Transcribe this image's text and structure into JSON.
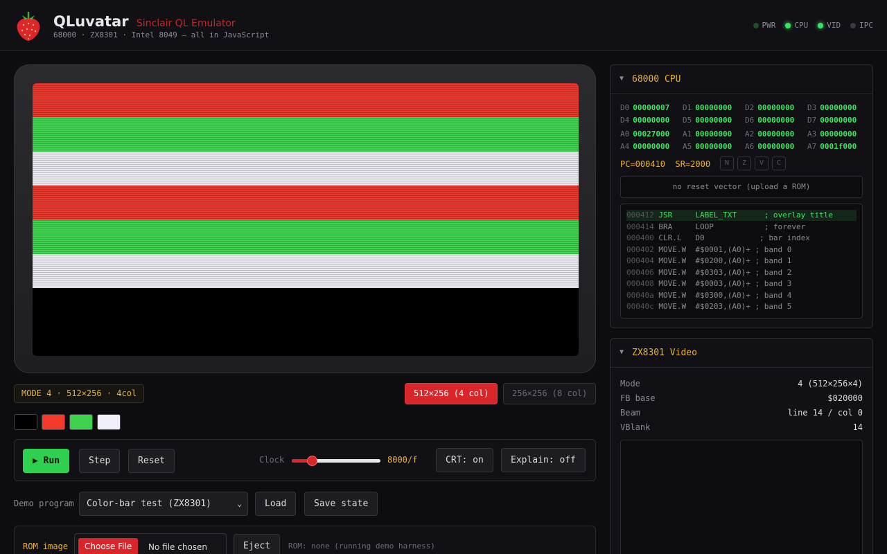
{
  "header": {
    "title": "QLuvatar",
    "subtitle": "Sinclair QL Emulator",
    "tagline": "68000 · ZX8301 · Intel 8049 — all in JavaScript",
    "logo_icon": "strawberry-icon",
    "leds": [
      {
        "label": "PWR",
        "state": "dim"
      },
      {
        "label": "CPU",
        "state": "on"
      },
      {
        "label": "VID",
        "state": "on"
      },
      {
        "label": "IPC",
        "state": "off"
      }
    ]
  },
  "screen": {
    "bands": [
      "#e8372e",
      "#3fd24f",
      "#e8e8ee",
      "#e8372e",
      "#3fd24f",
      "#e8e8ee"
    ],
    "background": "#000000"
  },
  "mode_badge": "MODE 4 · 512×256 · 4col",
  "resolution": {
    "active_label": "512×256 (4 col)",
    "inactive_label": "256×256 (8 col)"
  },
  "palette": [
    "#000000",
    "#f23a2b",
    "#3fd24f",
    "#f0f0fa"
  ],
  "controls": {
    "run_icon": "play-icon",
    "run_label": "Run",
    "step_label": "Step",
    "reset_label": "Reset",
    "clock_label": "Clock",
    "clock_level_fraction": 0.23,
    "clock_value": "8000/f",
    "crt_label": "CRT: on",
    "explain_label": "Explain: off"
  },
  "demo": {
    "label": "Demo program",
    "selected": "Color-bar test (ZX8301)",
    "load_label": "Load",
    "save_label": "Save state"
  },
  "rom": {
    "label": "ROM image",
    "choose_label": "Choose File",
    "file_text": "No file chosen",
    "eject_label": "Eject",
    "status": "ROM: none (running demo harness)"
  },
  "cpu_panel": {
    "title": "68000 CPU",
    "data_regs": [
      {
        "name": "D0",
        "value": "00000007"
      },
      {
        "name": "D1",
        "value": "00000000"
      },
      {
        "name": "D2",
        "value": "00000000"
      },
      {
        "name": "D3",
        "value": "00000000"
      },
      {
        "name": "D4",
        "value": "00000000"
      },
      {
        "name": "D5",
        "value": "00000000"
      },
      {
        "name": "D6",
        "value": "00000000"
      },
      {
        "name": "D7",
        "value": "00000000"
      }
    ],
    "addr_regs": [
      {
        "name": "A0",
        "value": "00027000"
      },
      {
        "name": "A1",
        "value": "00000000"
      },
      {
        "name": "A2",
        "value": "00000000"
      },
      {
        "name": "A3",
        "value": "00000000"
      },
      {
        "name": "A4",
        "value": "00000000"
      },
      {
        "name": "A5",
        "value": "00000000"
      },
      {
        "name": "A6",
        "value": "00000000"
      },
      {
        "name": "A7",
        "value": "0001f000"
      }
    ],
    "pc": "PC=000410",
    "sr": "SR=2000",
    "flags": [
      "N",
      "Z",
      "V",
      "C"
    ],
    "vector_message": "no reset vector (upload a ROM)",
    "disasm": [
      {
        "addr": "000412",
        "text": " JSR     LABEL_TXT      ; overlay title",
        "current": true
      },
      {
        "addr": "000414",
        "text": " BRA     LOOP           ; forever",
        "current": false
      },
      {
        "addr": "000400",
        "text": " CLR.L   D0            ; bar index",
        "current": false
      },
      {
        "addr": "000402",
        "text": " MOVE.W  #$0001,(A0)+ ; band 0",
        "current": false
      },
      {
        "addr": "000404",
        "text": " MOVE.W  #$0200,(A0)+ ; band 1",
        "current": false
      },
      {
        "addr": "000406",
        "text": " MOVE.W  #$0303,(A0)+ ; band 2",
        "current": false
      },
      {
        "addr": "000408",
        "text": " MOVE.W  #$0003,(A0)+ ; band 3",
        "current": false
      },
      {
        "addr": "00040a",
        "text": " MOVE.W  #$0300,(A0)+ ; band 4",
        "current": false
      },
      {
        "addr": "00040c",
        "text": " MOVE.W  #$0203,(A0)+ ; band 5",
        "current": false
      }
    ]
  },
  "video_panel": {
    "title": "ZX8301 Video",
    "rows": [
      {
        "key": "Mode",
        "value": "4 (512×256×4)"
      },
      {
        "key": "FB base",
        "value": "$020000"
      },
      {
        "key": "Beam",
        "value": "line 14 / col 0"
      },
      {
        "key": "VBlank",
        "value": "14"
      }
    ]
  }
}
